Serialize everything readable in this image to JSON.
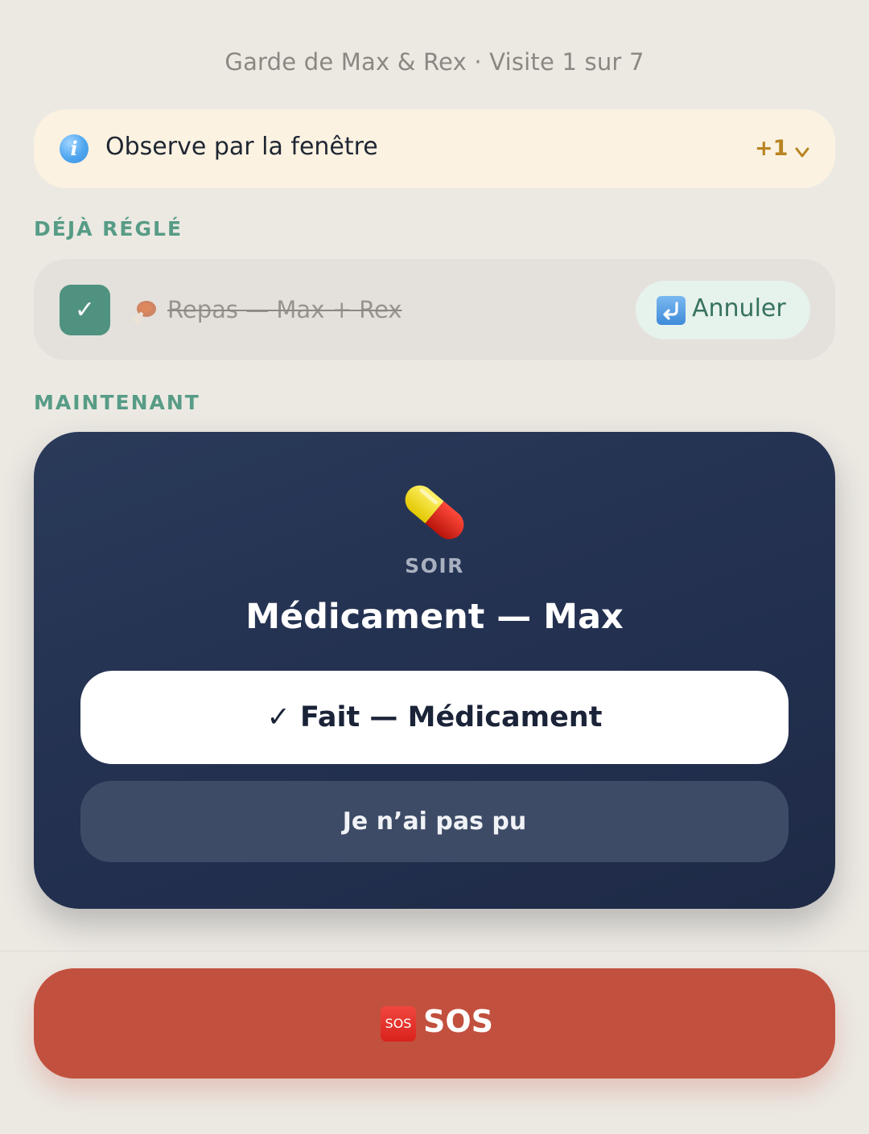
{
  "header": {
    "title": "Garde de Max & Rex · Visite 1 sur 7"
  },
  "info_banner": {
    "icon": "info-icon",
    "text": "Observe par la fenêtre",
    "more_count": "+1",
    "chevron_icon": "chevron-down-icon"
  },
  "done_section": {
    "label": "DÉJÀ RÉGLÉ",
    "item": {
      "check_glyph": "✓",
      "emoji": "meat-on-bone-icon",
      "text": "Repas — Max + Rex",
      "undo_icon": "return-arrow-icon",
      "undo_label": "Annuler"
    }
  },
  "now_section": {
    "label": "MAINTENANT",
    "task": {
      "icon": "pill-icon",
      "period": "SOIR",
      "title": "Médicament — Max",
      "done_button": "✓ Fait — Médicament",
      "skip_button": "Je n’ai pas pu"
    }
  },
  "sos": {
    "icon_text": "SOS",
    "label": "SOS"
  },
  "colors": {
    "background": "#ece9e3",
    "accent_green": "#579c86",
    "card_navy": "#233050",
    "sos_red": "#c2503e",
    "banner_cream": "#fbf2e1"
  }
}
